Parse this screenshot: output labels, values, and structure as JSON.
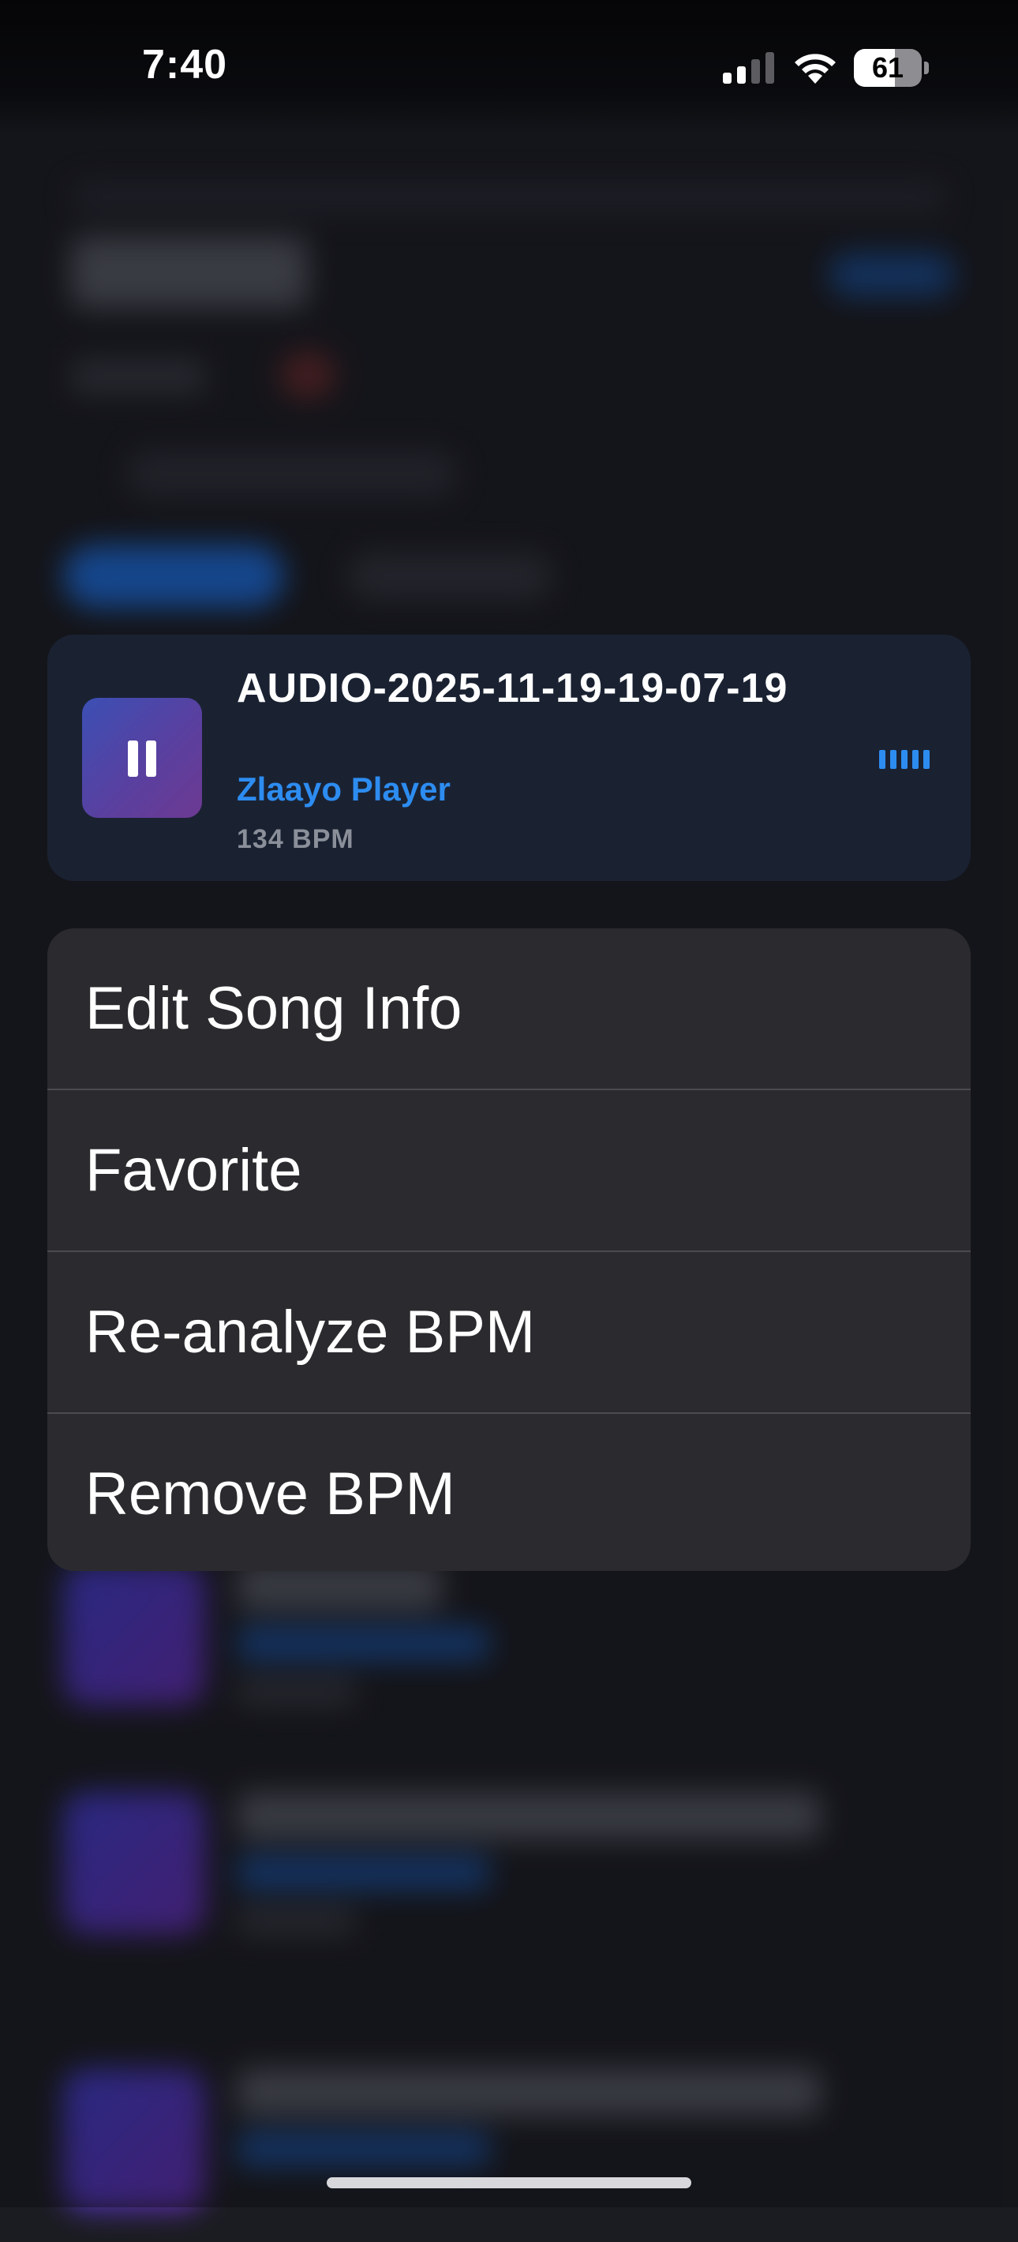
{
  "status_bar": {
    "time": "7:40",
    "battery_level": "61",
    "battery_fraction": 0.61,
    "icons": [
      "signal-icon",
      "wifi-icon",
      "battery-icon"
    ]
  },
  "song_card": {
    "title": "AUDIO-2025-11-19-19-07-19",
    "artist": "Zlaayo Player",
    "bpm": "134 BPM",
    "artwork_icon": "pause-icon",
    "playing_indicator_icon": "equalizer-icon"
  },
  "context_menu": {
    "items": [
      {
        "label": "Edit Song Info"
      },
      {
        "label": "Favorite"
      },
      {
        "label": "Re-analyze BPM"
      },
      {
        "label": "Remove BPM"
      }
    ]
  },
  "colors": {
    "accent": "#2d8cf0",
    "card_background": "#1a2232",
    "menu_background": "#2b2b2f",
    "page_background": "#1b1c21"
  }
}
